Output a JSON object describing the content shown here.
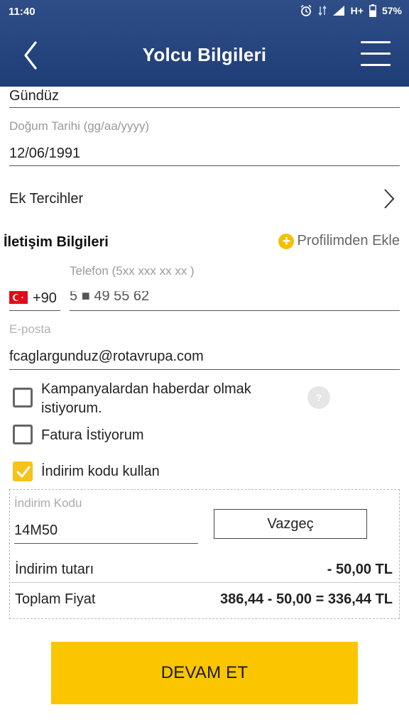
{
  "status_bar": {
    "time": "11:40",
    "network": "H+",
    "battery": "57%"
  },
  "header": {
    "title": "Yolcu Bilgileri",
    "back_icon": "chevron-left-icon",
    "menu_icon": "hamburger-menu-icon"
  },
  "form": {
    "surname_value": "Gündüz",
    "birthdate_label": "Doğum Tarihi (gg/aa/yyyy)",
    "birthdate_value": "12/06/1991",
    "extra_preferences_label": "Ek Tercihler"
  },
  "contact": {
    "section_title": "İletişim Bilgileri",
    "add_from_profile_label": "Profilimden Ekle",
    "phone_label": "Telefon (5xx xxx xx xx )",
    "country_code": "+90",
    "phone_value": "5  ■ 49 55 62",
    "email_label": "E-posta",
    "email_value": "fcaglargunduz@rotavrupa.com"
  },
  "options": {
    "campaign_label": "Kampanyalardan haberdar olmak istiyorum.",
    "campaign_checked": false,
    "help_symbol": "?",
    "invoice_label": "Fatura İstiyorum",
    "invoice_checked": false,
    "discount_label": "İndirim kodu kullan",
    "discount_checked": true
  },
  "discount": {
    "code_label": "İndirim Kodu",
    "code_value": "14M50",
    "cancel_label": "Vazgeç",
    "amount_label": "İndirim tutarı",
    "amount_value": "- 50,00 TL",
    "total_label": "Toplam Fiyat",
    "total_value": "386,44 - 50,00 = 336,44 TL"
  },
  "footer": {
    "continue_label": "DEVAM ET"
  },
  "colors": {
    "header_blue": "#243f7a",
    "accent_yellow": "#fbc500"
  }
}
